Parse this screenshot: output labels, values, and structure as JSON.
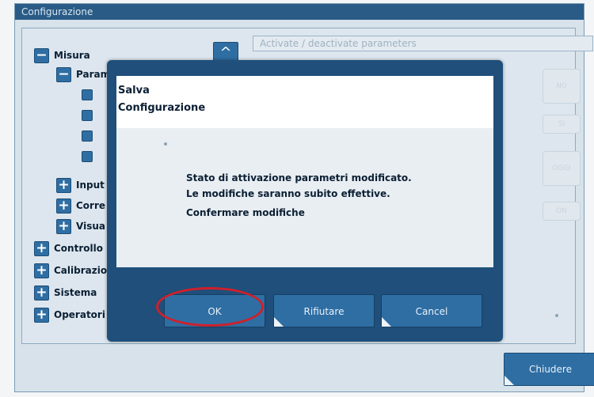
{
  "window": {
    "title": "Configurazione"
  },
  "tree": {
    "items": [
      {
        "label": "Misura",
        "sign": "−"
      },
      {
        "label": "Param",
        "sign": "−"
      },
      {
        "label": "Input",
        "sign": "+"
      },
      {
        "label": "Corre",
        "sign": "+"
      },
      {
        "label": "Visua",
        "sign": "+"
      },
      {
        "label": "Controllo",
        "sign": "+"
      },
      {
        "label": "Calibrazio",
        "sign": "+"
      },
      {
        "label": "Sistema",
        "sign": "+"
      },
      {
        "label": "Operatori",
        "sign": "+"
      }
    ]
  },
  "panel": {
    "header_text": "Activate / deactivate parameters",
    "up_icon": "^",
    "bg_buttons": [
      "NO",
      "SI",
      "OGGI",
      "ON"
    ]
  },
  "dialog": {
    "title_line1": "Salva",
    "title_line2": "Configurazione",
    "message_line1": "Stato di attivazione parametri modificato.",
    "message_line2": "Le modifiche saranno subito effettive.",
    "message_line3": "Confermare modifiche",
    "ok_label": "OK",
    "reject_label": "Rifiutare",
    "cancel_label": "Cancel",
    "highlight_color": "#d01f2a"
  },
  "footer": {
    "close_label": "Chiudere"
  }
}
